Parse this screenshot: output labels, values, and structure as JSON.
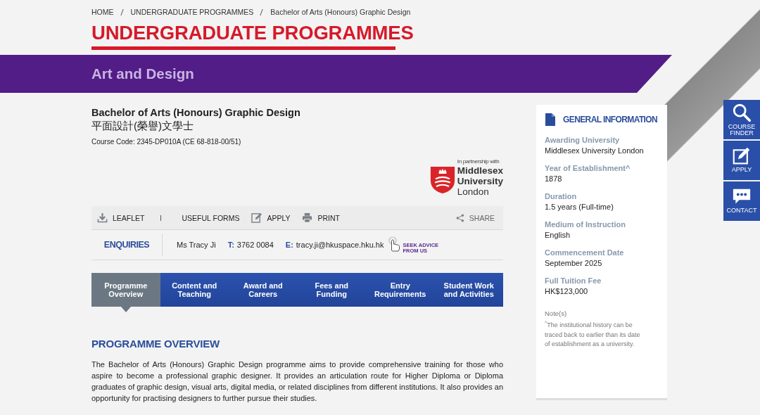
{
  "breadcrumb": [
    {
      "label": "HOME"
    },
    {
      "label": "UNDERGRADUATE PROGRAMMES"
    },
    {
      "label": "Bachelor of Arts (Honours) Graphic Design"
    }
  ],
  "page_title": "UNDERGRADUATE PROGRAMMES",
  "category": "Art and Design",
  "programme": {
    "title": "Bachelor of Arts (Honours) Graphic Design",
    "title_zh": "平面設計(榮譽)文學士",
    "course_code": "Course Code: 2345-DP010A (CE 68-818-00/51)"
  },
  "partner_logo": {
    "tagline": "In partnership with",
    "name_lines": [
      "Middlesex",
      "University",
      "London"
    ]
  },
  "toolbar": [
    {
      "kind": "download",
      "label": "LEAFLET"
    },
    {
      "kind": "divider"
    },
    {
      "kind": "plain",
      "label": "USEFUL FORMS"
    },
    {
      "kind": "edit",
      "label": "APPLY"
    },
    {
      "kind": "print",
      "label": "PRINT"
    },
    {
      "kind": "share",
      "label": "SHARE"
    }
  ],
  "enquiries": {
    "label": "ENQUIRIES",
    "contact_name": "Ms Tracy Ji",
    "phone_label": "T:",
    "phone": "3762 0084",
    "email_label": "E:",
    "email": "tracy.ji@hkuspace.hku.hk",
    "advice": "SEEK ADVICE FROM US"
  },
  "tabs": [
    {
      "label": "Programme Overview",
      "selected": true
    },
    {
      "label": "Content and Teaching",
      "selected": false
    },
    {
      "label": "Award and Careers",
      "selected": false
    },
    {
      "label": "Fees and Funding",
      "selected": false
    },
    {
      "label": "Entry Requirements",
      "selected": false
    },
    {
      "label": "Student Work and Activities",
      "selected": false
    }
  ],
  "section_heading": "PROGRAMME OVERVIEW",
  "overview": "The Bachelor of Arts (Honours) Graphic Design programme aims to provide comprehensive training for those who aspire to become a professional graphic designer. It provides an articulation route for Higher Diploma or Diploma graduates of graphic design, visual arts, digital media, or related disciplines from different institutions. It also provides an opportunity for practising designers to further pursue their studies.",
  "general_information": {
    "title": "GENERAL INFORMATION",
    "items": [
      {
        "label": "Awarding University",
        "value": "Middlesex University London"
      },
      {
        "label": "Year of Establishment^",
        "value": "1878"
      },
      {
        "label": "Duration",
        "value": "1.5 years (Full-time)"
      },
      {
        "label": "Medium of Instruction",
        "value": "English"
      },
      {
        "label": "Commencement Date",
        "value": "September 2025"
      },
      {
        "label": "Full Tuition Fee",
        "value": "HK$123,000"
      }
    ],
    "notes_title": "Note(s)",
    "note": "$^{^}$The institutional history can be traced back to earlier than its date of establishment as a university."
  },
  "side_buttons": [
    {
      "kind": "search",
      "label": "COURSE FINDER"
    },
    {
      "kind": "apply",
      "label": "APPLY"
    },
    {
      "kind": "contact",
      "label": "CONTACT"
    }
  ]
}
